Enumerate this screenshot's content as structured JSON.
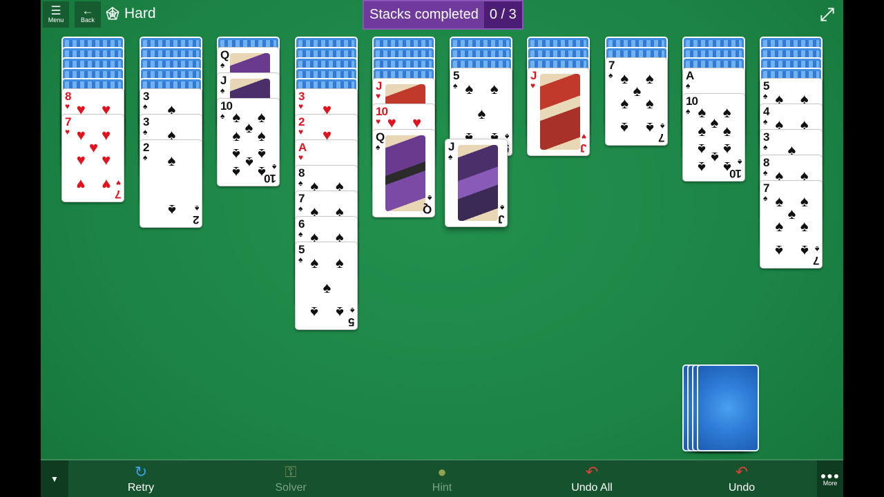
{
  "header": {
    "menu_label": "Menu",
    "back_label": "Back",
    "difficulty": "Hard",
    "stacks_label": "Stacks completed",
    "stacks_value": "0 / 3"
  },
  "colors": {
    "felt": "#1c8445",
    "stacks_badge": "#6f3a9c",
    "card_red": "#e0141e",
    "card_black": "#111111"
  },
  "tableau": [
    {
      "face_down": 5,
      "cards": [
        {
          "rank": "8",
          "suit": "hearts"
        },
        {
          "rank": "7",
          "suit": "hearts"
        }
      ]
    },
    {
      "face_down": 5,
      "cards": [
        {
          "rank": "3",
          "suit": "spades"
        },
        {
          "rank": "3",
          "suit": "spades"
        },
        {
          "rank": "2",
          "suit": "spades"
        }
      ]
    },
    {
      "face_down": 1,
      "cards": [
        {
          "rank": "Q",
          "suit": "spades"
        },
        {
          "rank": "J",
          "suit": "spades"
        },
        {
          "rank": "10",
          "suit": "spades"
        }
      ]
    },
    {
      "face_down": 5,
      "cards": [
        {
          "rank": "3",
          "suit": "hearts"
        },
        {
          "rank": "2",
          "suit": "hearts"
        },
        {
          "rank": "A",
          "suit": "hearts"
        },
        {
          "rank": "8",
          "suit": "spades"
        },
        {
          "rank": "7",
          "suit": "spades"
        },
        {
          "rank": "6",
          "suit": "spades"
        },
        {
          "rank": "5",
          "suit": "spades"
        }
      ]
    },
    {
      "face_down": 4,
      "cards": [
        {
          "rank": "J",
          "suit": "hearts"
        },
        {
          "rank": "10",
          "suit": "hearts"
        },
        {
          "rank": "Q",
          "suit": "spades"
        }
      ]
    },
    {
      "face_down": 3,
      "cards": [
        {
          "rank": "5",
          "suit": "spades"
        }
      ]
    },
    {
      "face_down": 3,
      "cards": [
        {
          "rank": "J",
          "suit": "hearts"
        }
      ]
    },
    {
      "face_down": 2,
      "cards": [
        {
          "rank": "7",
          "suit": "spades"
        }
      ]
    },
    {
      "face_down": 3,
      "cards": [
        {
          "rank": "A",
          "suit": "spades"
        },
        {
          "rank": "10",
          "suit": "spades"
        }
      ]
    },
    {
      "face_down": 4,
      "cards": [
        {
          "rank": "5",
          "suit": "spades"
        },
        {
          "rank": "4",
          "suit": "spades"
        },
        {
          "rank": "3",
          "suit": "spades"
        },
        {
          "rank": "8",
          "suit": "spades"
        },
        {
          "rank": "7",
          "suit": "spades"
        }
      ]
    }
  ],
  "dragging_card": {
    "rank": "J",
    "suit": "spades",
    "over_column": 6
  },
  "stock": {
    "remaining_deals": 4
  },
  "toolbar": {
    "retry": "Retry",
    "solver": "Solver",
    "hint": "Hint",
    "undo_all": "Undo All",
    "undo": "Undo",
    "more": "More"
  }
}
